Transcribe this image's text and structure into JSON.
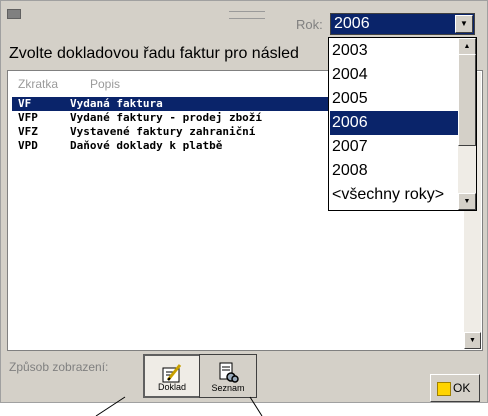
{
  "year": {
    "label": "Rok:",
    "selected": "2006",
    "options": [
      "2003",
      "2004",
      "2005",
      "2006",
      "2007",
      "2008",
      "<všechny roky>"
    ]
  },
  "instruction": "Zvolte dokladovou řadu faktur pro násled",
  "list": {
    "headers": [
      "Zkratka",
      "Popis"
    ],
    "rows": [
      {
        "code": "VF",
        "desc": "Vydaná faktura"
      },
      {
        "code": "VFP",
        "desc": "Vydané faktury - prodej zboží"
      },
      {
        "code": "VFZ",
        "desc": "Vystavené faktury zahraniční"
      },
      {
        "code": "VPD",
        "desc": "Daňové doklady k platbě"
      }
    ]
  },
  "view_mode": {
    "label": "Způsob zobrazení:",
    "doklad_label": "Doklad",
    "seznam_label": "Seznam"
  },
  "ok_label": "OK"
}
